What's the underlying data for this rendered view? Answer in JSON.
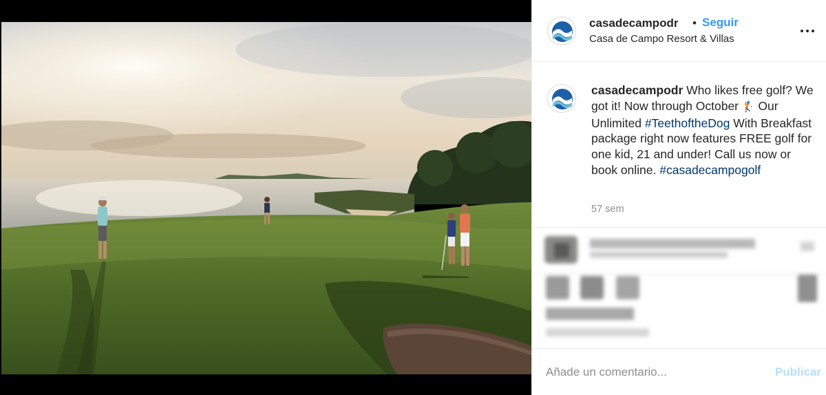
{
  "post": {
    "image_alt": "golf course by the sea at sunset",
    "colors": {
      "sky": "#e7dccb",
      "sea": "#c9c3b6",
      "grass": "#4f6a2a",
      "accent_link": "#3897f0",
      "hashtag": "#00376b"
    }
  },
  "header": {
    "username": "casadecampodr",
    "separator": "•",
    "follow_label": "Seguir",
    "location": "Casa de Campo Resort & Villas",
    "more_icon": "more-horizontal-icon"
  },
  "caption": {
    "username": "casadecampodr",
    "text_1": " Who likes free golf? We got it! Now through October ",
    "emoji": "🏌",
    "text_2": " Our Unlimited ",
    "hashtag_1": "#TeethoftheDog",
    "text_3": " With Breakfast package right now features FREE golf for one kid, 21 and under! Call us now or book online. ",
    "hashtag_2": "#casadecampogolf",
    "time": "57 sem"
  },
  "comment": {
    "placeholder": "Añade un comentario...",
    "publish_label": "Publicar"
  }
}
